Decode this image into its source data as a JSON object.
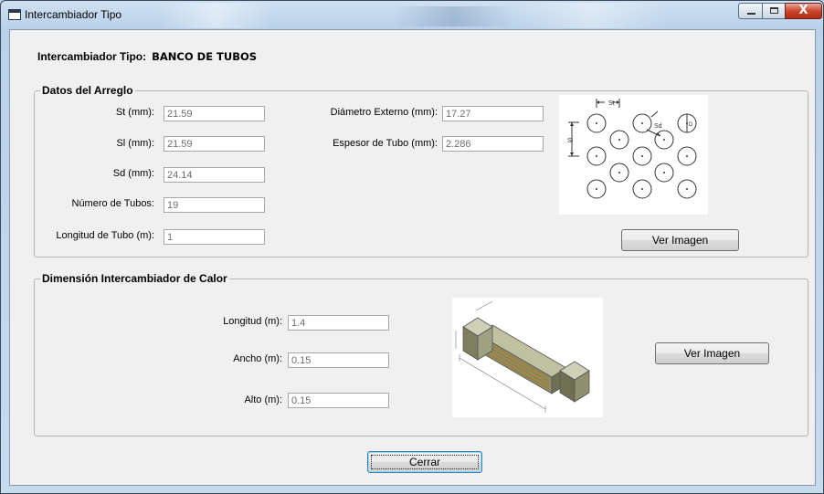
{
  "window": {
    "title": "Intercambiador Tipo",
    "close_glyph": "X",
    "colors": {
      "frame": "#bcd3ea",
      "client": "#f0f0f0",
      "close": "#c9462c"
    }
  },
  "heading": {
    "label": "Intercambiador Tipo:",
    "value": "BANCO DE TUBOS"
  },
  "datos_arreglo": {
    "legend": "Datos del Arreglo",
    "st": {
      "label": "St (mm):",
      "value": "21.59"
    },
    "sl": {
      "label": "Sl (mm):",
      "value": "21.59"
    },
    "sd": {
      "label": "Sd (mm):",
      "value": "24.14"
    },
    "num_tubos": {
      "label": "Número de Tubos:",
      "value": "19"
    },
    "longitud_tubo": {
      "label": "Longitud de Tubo (m):",
      "value": "1"
    },
    "diametro_externo": {
      "label": "Diámetro Externo (mm):",
      "value": "17.27"
    },
    "espesor_tubo": {
      "label": "Espesor de Tubo (mm):",
      "value": "2.286"
    },
    "image": {
      "st_label": "St",
      "sl_label": "Sl",
      "sd_label": "Sd",
      "d_label": "D"
    },
    "ver_imagen": "Ver Imagen"
  },
  "dimension": {
    "legend": "Dimensión Intercambiador de Calor",
    "longitud": {
      "label": "Longitud (m):",
      "value": "1.4"
    },
    "ancho": {
      "label": "Ancho (m):",
      "value": "0.15"
    },
    "alto": {
      "label": "Alto (m):",
      "value": "0.15"
    },
    "ver_imagen": "Ver Imagen"
  },
  "cerrar": "Cerrar"
}
